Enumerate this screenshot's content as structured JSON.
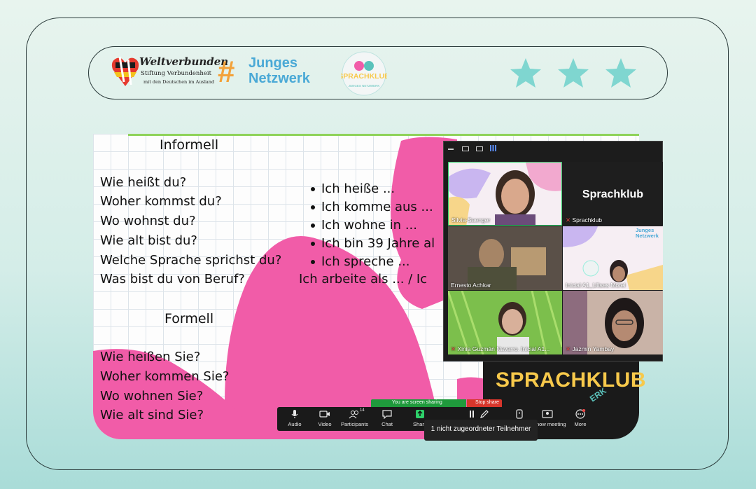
{
  "banner": {
    "weltverbunden": {
      "title": "Weltverbunden",
      "subtitle": "Stiftung Verbundenheit",
      "tagline": "mit den Deutschen im Ausland"
    },
    "junges_netzwerk": {
      "hash": "#",
      "line1": "Junges",
      "line2": "Netzwerk"
    },
    "sprachklub_logo": {
      "text": "SPRACHKLUB",
      "sub": "JUNGES NETZWERK"
    },
    "rating": {
      "stars": 3,
      "color": "#7fd6d0"
    }
  },
  "slide": {
    "informal_heading": "Informell",
    "informal_questions": [
      "Wie heißt du?",
      "Woher kommst du?",
      "Wo wohnst du?",
      "Wie alt bist du?",
      "Welche Sprache sprichst du?",
      "Was bist du von Beruf?"
    ],
    "answers": [
      "Ich heiße ...",
      "Ich komme aus ...",
      "Ich wohne in ...",
      "Ich bin 39 Jahre al",
      "Ich spreche ..."
    ],
    "answer_job": "Ich arbeite als ... / Ic",
    "formal_heading": "Formell",
    "formal_questions": [
      "Wie heißen Sie?",
      "Woher kommen Sie?",
      "Wo wohnen Sie?",
      "Wie alt sind Sie?"
    ],
    "accent_pink": "#f15ca8",
    "accent_yellow": "#f7c94b"
  },
  "meeting": {
    "participants": [
      {
        "name": "Silvia-Saenger"
      },
      {
        "name": "Sprachklub",
        "title": "Sprachklub"
      },
      {
        "name": "Ernesto Achkar"
      },
      {
        "name": "Inicial A1_Ulises Morel"
      },
      {
        "name": "Xinia Guzmán Navarro. Inicial A1..."
      },
      {
        "name": "Jazmin Yambay"
      }
    ],
    "tile_logo_text": "Junges Netzwerk",
    "share_bar": "You are screen sharing",
    "stop_share": "Stop share",
    "toolbar": {
      "audio": "Audio",
      "video": "Video",
      "participants": "Participants",
      "participants_count": "14",
      "chat": "Chat",
      "share": "Share",
      "show_meeting": "Show meeting",
      "more": "More"
    },
    "tooltip": "1 nicht zugeordneter Teilnehmer"
  },
  "slide_brand": {
    "text": "SPRACHKLUB",
    "sub": "ERK"
  }
}
